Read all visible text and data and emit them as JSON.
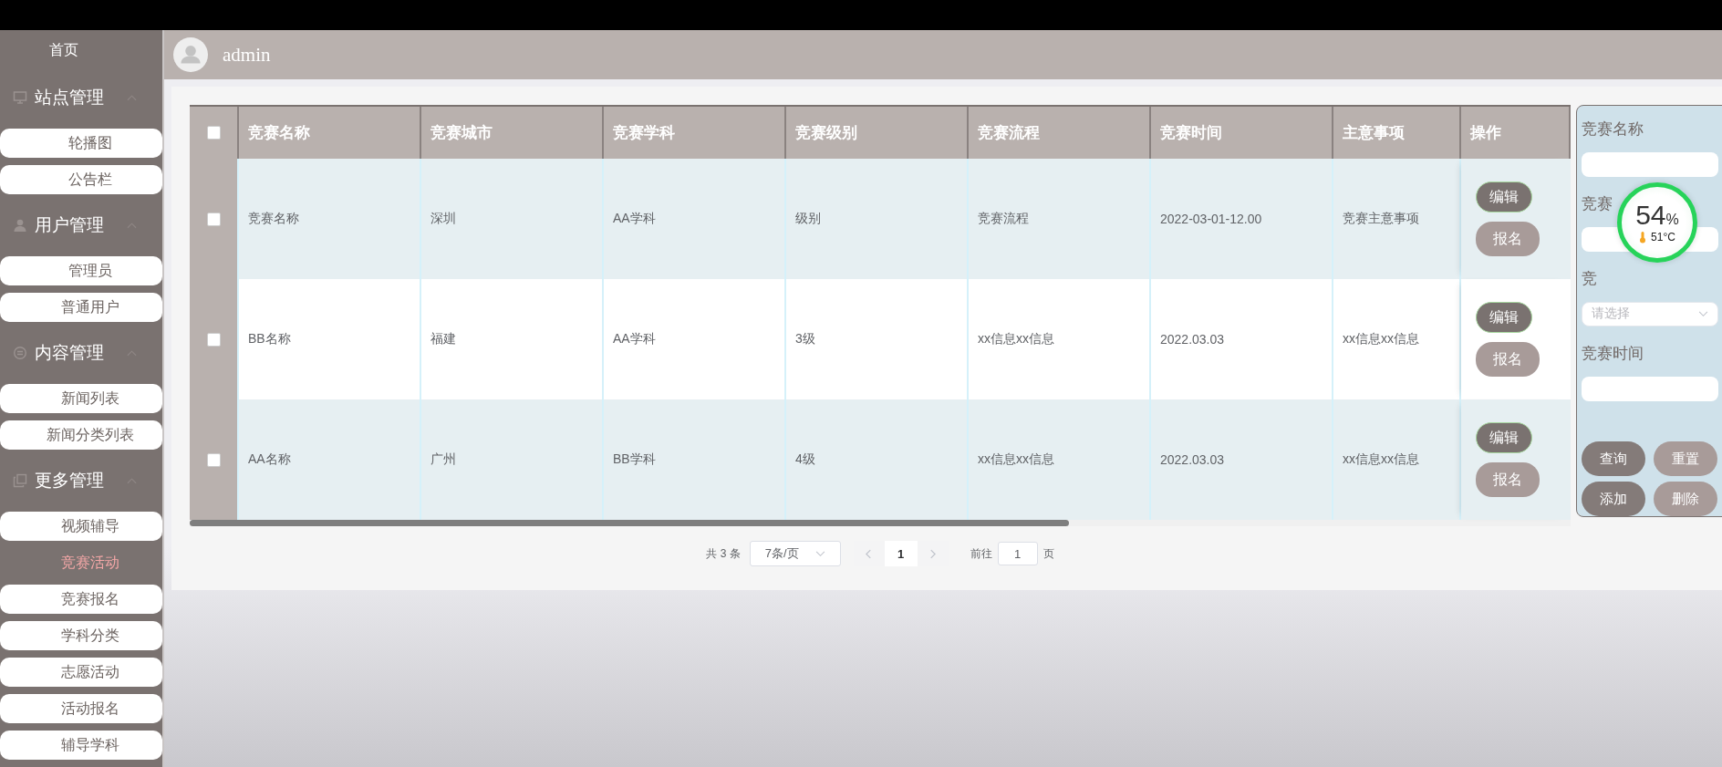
{
  "user": {
    "name": "admin"
  },
  "sidebar": {
    "items": [
      {
        "kind": "link",
        "label": "首页"
      },
      {
        "kind": "group",
        "label": "站点管理",
        "expanded": true,
        "children": [
          {
            "label": "轮播图",
            "selected": false
          },
          {
            "label": "公告栏",
            "selected": false
          }
        ]
      },
      {
        "kind": "group",
        "label": "用户管理",
        "expanded": true,
        "children": [
          {
            "label": "管理员",
            "selected": false
          },
          {
            "label": "普通用户",
            "selected": false
          }
        ]
      },
      {
        "kind": "group",
        "label": "内容管理",
        "expanded": true,
        "children": [
          {
            "label": "新闻列表",
            "selected": false
          },
          {
            "label": "新闻分类列表",
            "selected": false
          }
        ]
      },
      {
        "kind": "group",
        "label": "更多管理",
        "expanded": true,
        "children": [
          {
            "label": "视频辅导",
            "selected": false
          },
          {
            "label": "竞赛活动",
            "selected": true
          },
          {
            "label": "竞赛报名",
            "selected": false
          },
          {
            "label": "学科分类",
            "selected": false
          },
          {
            "label": "志愿活动",
            "selected": false
          },
          {
            "label": "活动报名",
            "selected": false
          },
          {
            "label": "辅导学科",
            "selected": false
          }
        ]
      }
    ]
  },
  "table": {
    "all_checked": false,
    "columns": [
      "竞赛名称",
      "竞赛城市",
      "竞赛学科",
      "竞赛级别",
      "竞赛流程",
      "竞赛时间",
      "主意事项",
      "操作"
    ],
    "rows": [
      {
        "checked": false,
        "cells": [
          "竞赛名称",
          "深圳",
          "AA学科",
          "级别",
          "竞赛流程",
          "2022-03-01-12.00",
          "竞赛主意事项"
        ],
        "actions": [
          {
            "label": "编辑",
            "kind": "primary"
          },
          {
            "label": "报名",
            "kind": "secondary"
          }
        ]
      },
      {
        "checked": false,
        "cells": [
          "BB名称",
          "福建",
          "AA学科",
          "3级",
          "xx信息xx信息",
          "2022.03.03",
          "xx信息xx信息"
        ],
        "actions": [
          {
            "label": "编辑",
            "kind": "primary"
          },
          {
            "label": "报名",
            "kind": "secondary"
          }
        ]
      },
      {
        "checked": false,
        "cells": [
          "AA名称",
          "广州",
          "BB学科",
          "4级",
          "xx信息xx信息",
          "2022.03.03",
          "xx信息xx信息"
        ],
        "actions": [
          {
            "label": "编辑",
            "kind": "primary"
          },
          {
            "label": "报名",
            "kind": "secondary"
          }
        ]
      }
    ]
  },
  "pagination": {
    "total": "共 3 条",
    "page_size": "7条/页",
    "pages": [
      {
        "label": "1",
        "selected": true
      }
    ],
    "goto_label": "前往",
    "goto_value": "1",
    "goto_suffix": "页"
  },
  "search_panel": {
    "fields": [
      {
        "kind": "input",
        "label": "竞赛名称"
      },
      {
        "kind": "input",
        "label": "竞赛"
      },
      {
        "kind": "select",
        "label": "竞",
        "placeholder": "请选择"
      },
      {
        "kind": "input",
        "label": "竞赛时间"
      }
    ],
    "buttons": [
      {
        "label": "查询",
        "kind": "primary"
      },
      {
        "label": "重置",
        "kind": "secondary"
      },
      {
        "label": "添加",
        "kind": "primary"
      },
      {
        "label": "删除",
        "kind": "secondary"
      }
    ]
  },
  "monitor_widget": {
    "value": "54",
    "unit": "%",
    "temperature": "51°C"
  }
}
